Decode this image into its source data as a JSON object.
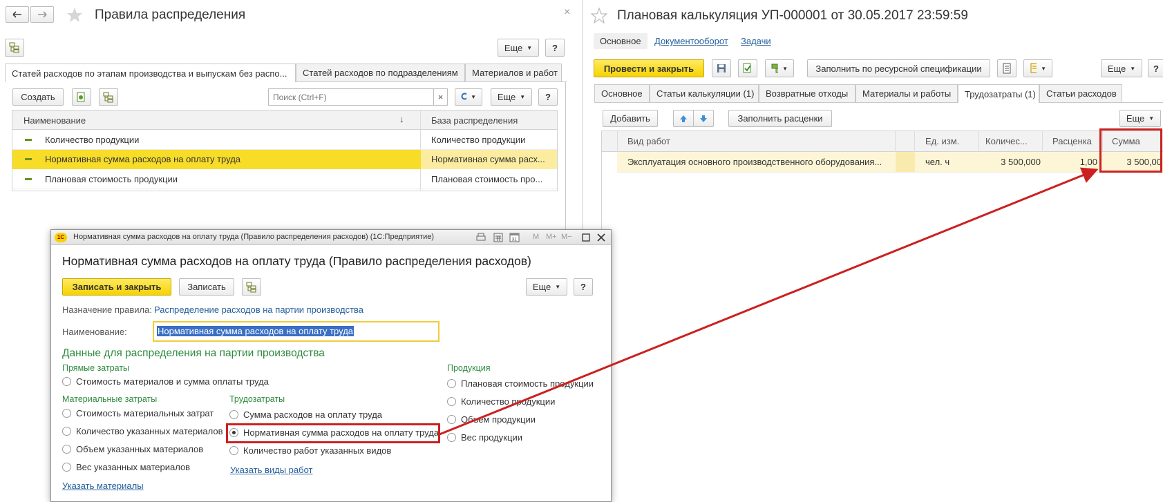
{
  "left_window": {
    "title": "Правила распределения",
    "close": "×",
    "more_label": "Еще",
    "help_label": "?",
    "tabs": [
      "Статей расходов по этапам производства и выпускам без распо...",
      "Статей расходов по подразделениям",
      "Материалов и работ"
    ],
    "create_label": "Создать",
    "search_placeholder": "Поиск (Ctrl+F)",
    "search_clear": "×",
    "columns": [
      "Наименование",
      "База распределения"
    ],
    "sort_arrow": "↓",
    "rows": [
      {
        "name": "Количество продукции",
        "base": "Количество продукции"
      },
      {
        "name": "Нормативная сумма расходов на оплату труда",
        "base": "Нормативная сумма расх..."
      },
      {
        "name": "Плановая стоимость продукции",
        "base": "Плановая стоимость про..."
      }
    ],
    "selected_row": 1
  },
  "right_window": {
    "title": "Плановая калькуляция УП-000001 от 30.05.2017 23:59:59",
    "nav": [
      "Основное",
      "Документооборот",
      "Задачи"
    ],
    "post_close_label": "Провести и закрыть",
    "fill_spec_label": "Заполнить по ресурсной спецификации",
    "more_label": "Еще",
    "help_label": "?",
    "tabs": [
      "Основное",
      "Статьи калькуляции (1)",
      "Возвратные отходы",
      "Материалы и работы",
      "Трудозатраты (1)",
      "Статьи расходов"
    ],
    "active_tab": 4,
    "add_label": "Добавить",
    "fill_rates_label": "Заполнить расценки",
    "columns": [
      "Вид работ",
      "Ед. изм.",
      "Количес...",
      "Расценка",
      "Сумма"
    ],
    "rows": [
      {
        "work": "Эксплуатация основного производственного оборудования...",
        "unit": "чел. ч",
        "qty": "3 500,000",
        "rate": "1,00",
        "sum": "3 500,00"
      }
    ]
  },
  "dialog": {
    "window_title": "Нормативная сумма расходов на оплату труда (Правило распределения расходов)  (1С:Предприятие)",
    "title": "Нормативная сумма расходов на оплату труда (Правило распределения расходов)",
    "logo": "1С",
    "save_close_label": "Записать и закрыть",
    "save_label": "Записать",
    "more_label": "Еще",
    "help_label": "?",
    "purpose_label": "Назначение правила:",
    "purpose_value": "Распределение расходов на партии производства",
    "name_label": "Наименование:",
    "name_value": "Нормативная сумма расходов на оплату труда",
    "section_title": "Данные для распределения на партии производства",
    "direct_title": "Прямые затраты",
    "direct_options": [
      "Стоимость материалов и сумма оплаты труда"
    ],
    "material_title": "Материальные затраты",
    "material_options": [
      "Стоимость материальных затрат",
      "Количество указанных материалов",
      "Объем указанных материалов",
      "Вес указанных материалов"
    ],
    "material_link": "Указать материалы",
    "labor_title": "Трудозатраты",
    "labor_options": [
      "Сумма расходов на оплату труда",
      "Нормативная сумма расходов на оплату труда",
      "Количество работ указанных видов"
    ],
    "labor_selected": 1,
    "labor_link": "Указать виды работ",
    "product_title": "Продукция",
    "product_options": [
      "Плановая стоимость продукции",
      "Количество продукции",
      "Объем продукции",
      "Вес продукции"
    ],
    "titlebar_icons": [
      "M",
      "M+",
      "M−"
    ]
  },
  "colors": {
    "accent_yellow": "#f5d300",
    "highlight": "#cc2020",
    "link": "#25609c",
    "section_green": "#2d8a3d"
  }
}
